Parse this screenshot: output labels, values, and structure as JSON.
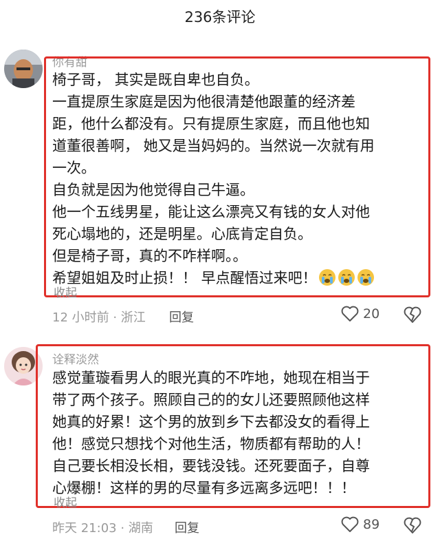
{
  "header": {
    "title": "236条评论"
  },
  "comments": [
    {
      "username": "你有甜",
      "lines": [
        "椅子哥， 其实是既自卑也自负。",
        "一直提原生家庭是因为他很清楚他跟董的经济差",
        "距，他什么都没有。只有提原生家庭，而且他也知",
        "道董很善啊， 她又是当妈妈的。当然说一次就有用",
        "一次。",
        "自负就是因为他觉得自己牛逼。",
        "他一个五线男星，能让这么漂亮又有钱的女人对他",
        "死心塌地的，还是明星。心底肯定自负。",
        "但是椅子哥，真的不咋样啊。。",
        "希望姐姐及时止损！！ 早点醒悟过来吧！"
      ],
      "emojis": [
        "crying-face-icon",
        "crying-face-icon",
        "crying-face-icon"
      ],
      "collapse_label": "收起",
      "meta": "12 小时前 · 浙江",
      "reply_label": "回复",
      "likes": "20"
    },
    {
      "username": "诠释淡然",
      "lines": [
        "感觉董璇看男人的眼光真的不咋地，她现在相当于",
        "带了两个孩子。照顾自己的的女儿还要照顾他这样",
        "她真的好累！这个男的放到乡下去都没女的看得上",
        "他！感觉只想找个对他生活，物质都有帮助的人！",
        "自己要长相没长相，要钱没钱。还死要面子，自尊",
        "心爆棚！这样的男的尽量有多远离多远吧！！！"
      ],
      "collapse_label": "收起",
      "meta": "昨天 21:03 · 湖南",
      "reply_label": "回复",
      "likes": "89"
    }
  ],
  "colors": {
    "highlight_border": "#e0302a",
    "meta_gray": "#9a9a9a"
  }
}
